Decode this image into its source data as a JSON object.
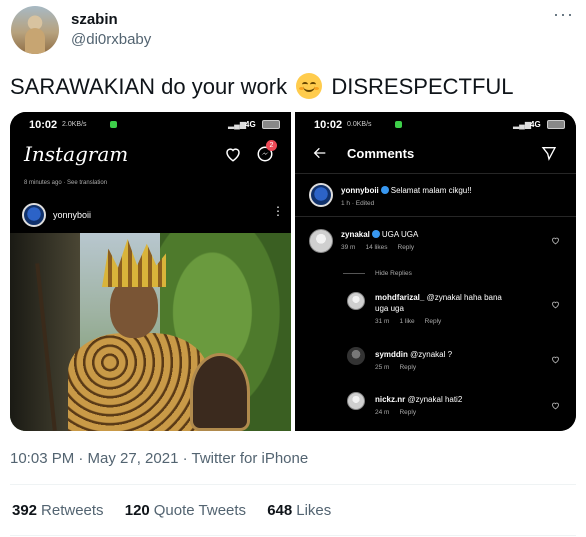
{
  "tweet": {
    "display_name": "szabin",
    "handle": "@di0rxbaby",
    "text_before": "SARAWAKIAN do your work",
    "emoji": "smiling-face-with-smiling-eyes",
    "text_after": "DISRESPECTFUL",
    "timestamp": "10:03 PM · May 27, 2021 · Twitter for iPhone",
    "stats": {
      "retweets_count": "392",
      "retweets_label": "Retweets",
      "quotes_count": "120",
      "quotes_label": "Quote Tweets",
      "likes_count": "648",
      "likes_label": "Likes"
    }
  },
  "screenshot_left": {
    "status_time": "10:02",
    "status_speed": "2.0KB/s",
    "network": "4G",
    "app_logo": "Instagram",
    "notification_count": "2",
    "time_note": "8 minutes ago · See translation",
    "post_username": "yonnyboii"
  },
  "screenshot_right": {
    "status_time": "10:02",
    "status_speed": "0.0KB/s",
    "network": "4G",
    "title": "Comments",
    "hide_replies": "Hide Replies",
    "comments": [
      {
        "user": "yonnyboii",
        "text": "Selamat malam cikgu!!",
        "meta": [
          "1 h · Edited"
        ]
      },
      {
        "user": "zynakal",
        "text": "UGA UGA",
        "meta": [
          "39 m",
          "14 likes",
          "Reply"
        ]
      },
      {
        "user": "mohdfarizal_",
        "text": "@zynakal haha bana",
        "text2": "uga uga",
        "meta": [
          "31 m",
          "1 like",
          "Reply"
        ]
      },
      {
        "user": "symddin",
        "text": "@zynakal ?",
        "meta": [
          "25 m",
          "Reply"
        ]
      },
      {
        "user": "nickz.nr",
        "text": "@zynakal hati2",
        "meta": [
          "24 m",
          "Reply"
        ]
      }
    ]
  }
}
